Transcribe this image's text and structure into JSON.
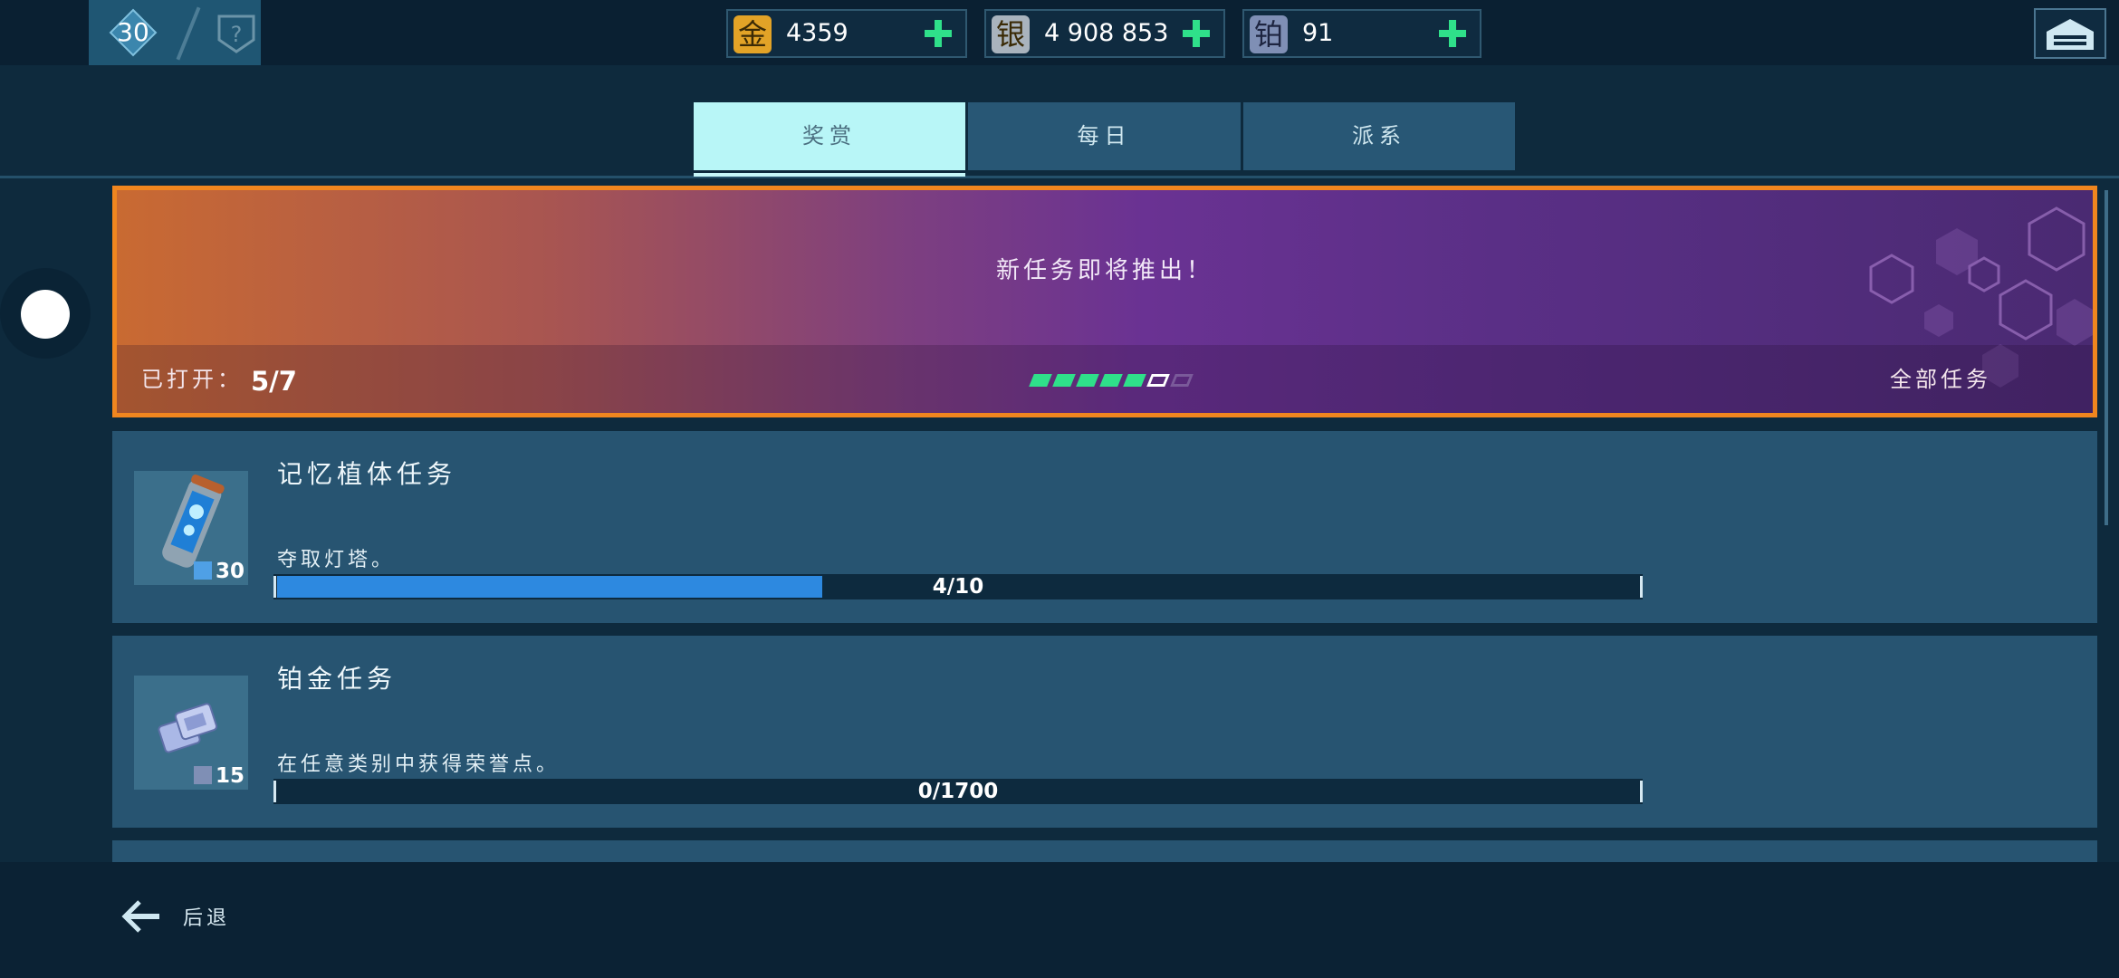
{
  "player": {
    "level": "30"
  },
  "currencies": [
    {
      "name": "gold",
      "glyph": "金",
      "value": "4359",
      "color": "#e2a327"
    },
    {
      "name": "silver",
      "glyph": "银",
      "value": "4 908 853",
      "color": "#a9b3bd"
    },
    {
      "name": "platinum",
      "glyph": "铂",
      "value": "91",
      "color": "#7f8fb5"
    }
  ],
  "tabs": [
    {
      "label": "奖赏",
      "active": true
    },
    {
      "label": "每日",
      "active": false
    },
    {
      "label": "派系",
      "active": false
    }
  ],
  "banner": {
    "message": "新任务即将推出！",
    "opened_label": "已打开：",
    "opened_value": "5/7",
    "progress_filled": 5,
    "progress_total": 7,
    "all_tasks_label": "全部任务"
  },
  "missions": [
    {
      "title": "记忆植体任务",
      "description": "夺取灯塔。",
      "progress_text": "4/10",
      "progress_fraction": 0.4,
      "reward_amount": "30",
      "reward_icon": "memory-implant-icon"
    },
    {
      "title": "铂金任务",
      "description": "在任意类别中获得荣誉点。",
      "progress_text": "0/1700",
      "progress_fraction": 0,
      "reward_amount": "15",
      "reward_icon": "platinum-icon"
    }
  ],
  "footer": {
    "back_label": "后退"
  },
  "colors": {
    "accent_cyan": "#b8f6f7",
    "banner_border": "#f0861f",
    "progress_blue": "#2d89e0",
    "plus_green": "#2fe08a"
  }
}
